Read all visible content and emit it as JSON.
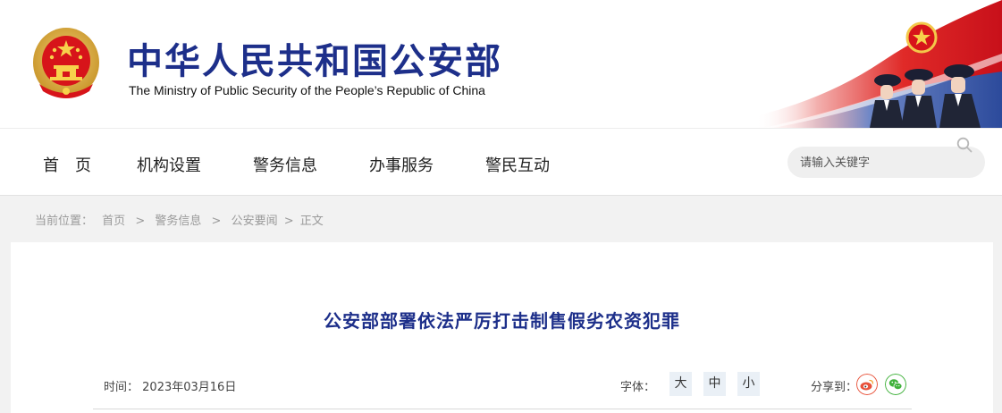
{
  "header": {
    "title": "中华人民共和国公安部",
    "subtitle": "The Ministry of Public Security of the People’s Republic of China",
    "colors": {
      "brand_blue": "#1d2f8a",
      "flag_red": "#d7141a"
    }
  },
  "nav": {
    "items": [
      {
        "label": "首　页"
      },
      {
        "label": "机构设置"
      },
      {
        "label": "警务信息"
      },
      {
        "label": "办事服务"
      },
      {
        "label": "警民互动"
      }
    ],
    "search": {
      "placeholder": "请输入关键字",
      "value": "",
      "icon": "search-icon"
    }
  },
  "breadcrumb": {
    "prefix": "当前位置：",
    "items": [
      "首页",
      "警务信息",
      "公安要闻"
    ],
    "current": "正文",
    "separator": ">"
  },
  "article": {
    "title": "公安部部署依法严厉打击制售假劣农资犯罪",
    "time_label": "时间：",
    "date": "2023年03月16日",
    "font_label": "字体：",
    "font_sizes": [
      "大",
      "中",
      "小"
    ],
    "share_label": "分享到：",
    "share_icons": [
      "weibo-icon",
      "wechat-icon"
    ]
  }
}
